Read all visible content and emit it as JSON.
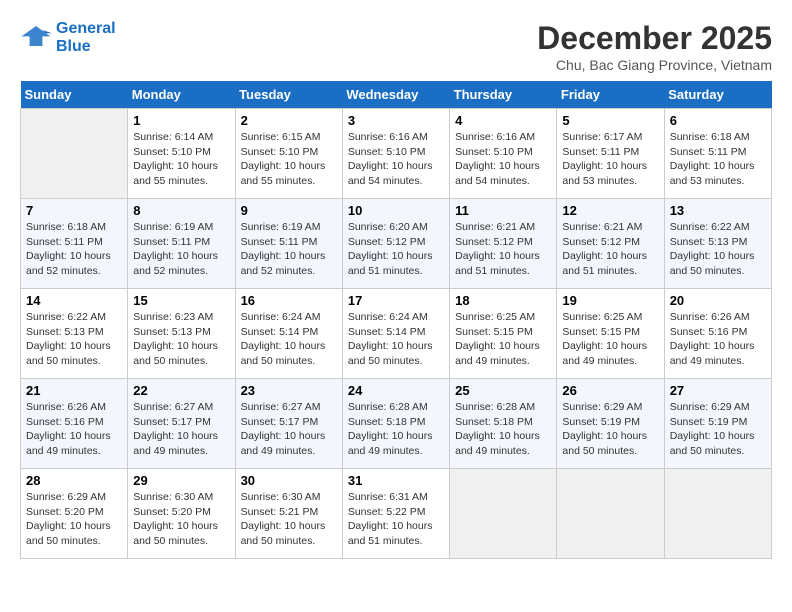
{
  "header": {
    "logo_line1": "General",
    "logo_line2": "Blue",
    "month_year": "December 2025",
    "location": "Chu, Bac Giang Province, Vietnam"
  },
  "weekdays": [
    "Sunday",
    "Monday",
    "Tuesday",
    "Wednesday",
    "Thursday",
    "Friday",
    "Saturday"
  ],
  "weeks": [
    [
      {
        "day": "",
        "empty": true
      },
      {
        "day": "1",
        "sunrise": "6:14 AM",
        "sunset": "5:10 PM",
        "daylight": "10 hours and 55 minutes."
      },
      {
        "day": "2",
        "sunrise": "6:15 AM",
        "sunset": "5:10 PM",
        "daylight": "10 hours and 55 minutes."
      },
      {
        "day": "3",
        "sunrise": "6:16 AM",
        "sunset": "5:10 PM",
        "daylight": "10 hours and 54 minutes."
      },
      {
        "day": "4",
        "sunrise": "6:16 AM",
        "sunset": "5:10 PM",
        "daylight": "10 hours and 54 minutes."
      },
      {
        "day": "5",
        "sunrise": "6:17 AM",
        "sunset": "5:11 PM",
        "daylight": "10 hours and 53 minutes."
      },
      {
        "day": "6",
        "sunrise": "6:18 AM",
        "sunset": "5:11 PM",
        "daylight": "10 hours and 53 minutes."
      }
    ],
    [
      {
        "day": "7",
        "sunrise": "6:18 AM",
        "sunset": "5:11 PM",
        "daylight": "10 hours and 52 minutes."
      },
      {
        "day": "8",
        "sunrise": "6:19 AM",
        "sunset": "5:11 PM",
        "daylight": "10 hours and 52 minutes."
      },
      {
        "day": "9",
        "sunrise": "6:19 AM",
        "sunset": "5:11 PM",
        "daylight": "10 hours and 52 minutes."
      },
      {
        "day": "10",
        "sunrise": "6:20 AM",
        "sunset": "5:12 PM",
        "daylight": "10 hours and 51 minutes."
      },
      {
        "day": "11",
        "sunrise": "6:21 AM",
        "sunset": "5:12 PM",
        "daylight": "10 hours and 51 minutes."
      },
      {
        "day": "12",
        "sunrise": "6:21 AM",
        "sunset": "5:12 PM",
        "daylight": "10 hours and 51 minutes."
      },
      {
        "day": "13",
        "sunrise": "6:22 AM",
        "sunset": "5:13 PM",
        "daylight": "10 hours and 50 minutes."
      }
    ],
    [
      {
        "day": "14",
        "sunrise": "6:22 AM",
        "sunset": "5:13 PM",
        "daylight": "10 hours and 50 minutes."
      },
      {
        "day": "15",
        "sunrise": "6:23 AM",
        "sunset": "5:13 PM",
        "daylight": "10 hours and 50 minutes."
      },
      {
        "day": "16",
        "sunrise": "6:24 AM",
        "sunset": "5:14 PM",
        "daylight": "10 hours and 50 minutes."
      },
      {
        "day": "17",
        "sunrise": "6:24 AM",
        "sunset": "5:14 PM",
        "daylight": "10 hours and 50 minutes."
      },
      {
        "day": "18",
        "sunrise": "6:25 AM",
        "sunset": "5:15 PM",
        "daylight": "10 hours and 49 minutes."
      },
      {
        "day": "19",
        "sunrise": "6:25 AM",
        "sunset": "5:15 PM",
        "daylight": "10 hours and 49 minutes."
      },
      {
        "day": "20",
        "sunrise": "6:26 AM",
        "sunset": "5:16 PM",
        "daylight": "10 hours and 49 minutes."
      }
    ],
    [
      {
        "day": "21",
        "sunrise": "6:26 AM",
        "sunset": "5:16 PM",
        "daylight": "10 hours and 49 minutes."
      },
      {
        "day": "22",
        "sunrise": "6:27 AM",
        "sunset": "5:17 PM",
        "daylight": "10 hours and 49 minutes."
      },
      {
        "day": "23",
        "sunrise": "6:27 AM",
        "sunset": "5:17 PM",
        "daylight": "10 hours and 49 minutes."
      },
      {
        "day": "24",
        "sunrise": "6:28 AM",
        "sunset": "5:18 PM",
        "daylight": "10 hours and 49 minutes."
      },
      {
        "day": "25",
        "sunrise": "6:28 AM",
        "sunset": "5:18 PM",
        "daylight": "10 hours and 49 minutes."
      },
      {
        "day": "26",
        "sunrise": "6:29 AM",
        "sunset": "5:19 PM",
        "daylight": "10 hours and 50 minutes."
      },
      {
        "day": "27",
        "sunrise": "6:29 AM",
        "sunset": "5:19 PM",
        "daylight": "10 hours and 50 minutes."
      }
    ],
    [
      {
        "day": "28",
        "sunrise": "6:29 AM",
        "sunset": "5:20 PM",
        "daylight": "10 hours and 50 minutes."
      },
      {
        "day": "29",
        "sunrise": "6:30 AM",
        "sunset": "5:20 PM",
        "daylight": "10 hours and 50 minutes."
      },
      {
        "day": "30",
        "sunrise": "6:30 AM",
        "sunset": "5:21 PM",
        "daylight": "10 hours and 50 minutes."
      },
      {
        "day": "31",
        "sunrise": "6:31 AM",
        "sunset": "5:22 PM",
        "daylight": "10 hours and 51 minutes."
      },
      {
        "day": "",
        "empty": true
      },
      {
        "day": "",
        "empty": true
      },
      {
        "day": "",
        "empty": true
      }
    ]
  ]
}
